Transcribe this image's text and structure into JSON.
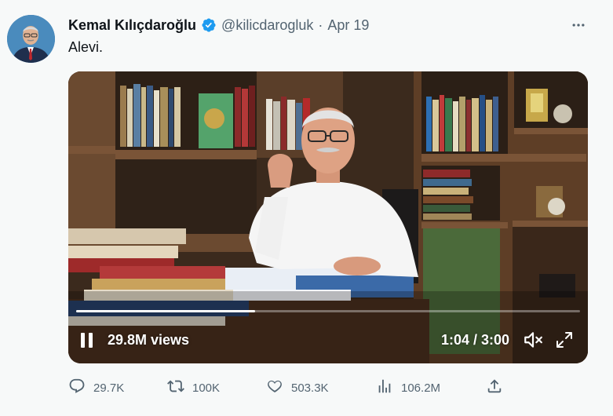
{
  "tweet": {
    "author_name": "Kemal Kılıçdaroğlu",
    "handle": "@kilicdarogluk",
    "separator": "·",
    "date": "Apr 19",
    "text": "Alevi.",
    "verified": true
  },
  "video": {
    "views_label": "29.8M views",
    "time_label": "1:04 / 3:00",
    "progress_fraction": 0.355,
    "muted": true
  },
  "actions": {
    "replies": "29.7K",
    "retweets": "100K",
    "likes": "503.3K",
    "views": "106.2M"
  },
  "icons": {
    "more": "more-icon",
    "reply": "reply-icon",
    "retweet": "retweet-icon",
    "like": "heart-icon",
    "views": "analytics-icon",
    "share": "share-icon",
    "verified": "verified-badge-icon",
    "pause": "pause-icon",
    "mute": "muted-speaker-icon",
    "fullscreen": "fullscreen-icon"
  },
  "colors": {
    "text_primary": "#0f1419",
    "text_secondary": "#536471",
    "verified_blue": "#1d9bf0",
    "background": "#f7f9f9"
  }
}
